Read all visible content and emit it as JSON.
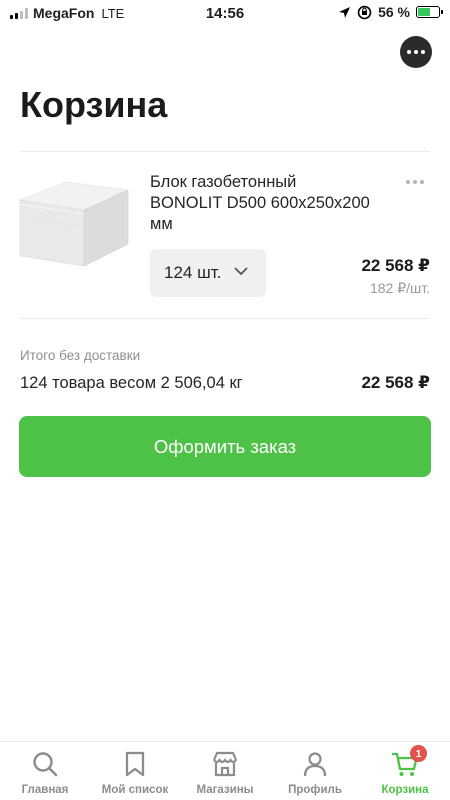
{
  "status_bar": {
    "carrier": "MegaFon",
    "network": "LTE",
    "time": "14:56",
    "battery": "56 %",
    "battery_level": 0.56
  },
  "header": {
    "title": "Корзина",
    "more_icon": "ellipsis-icon"
  },
  "cart": {
    "items": [
      {
        "name": "Блок газобетонный BONOLIT D500 600x250x200 мм",
        "quantity": "124 шт.",
        "total_price": "22 568 ₽",
        "unit_price": "182 ₽/шт."
      }
    ]
  },
  "summary": {
    "caption": "Итого без доставки",
    "description": "124 товара весом 2 506,04 кг",
    "total": "22 568 ₽"
  },
  "checkout": {
    "label": "Оформить заказ"
  },
  "tab_bar": {
    "tabs": [
      {
        "label": "Главная",
        "icon": "search-icon"
      },
      {
        "label": "Мой список",
        "icon": "bookmark-icon"
      },
      {
        "label": "Магазины",
        "icon": "store-icon"
      },
      {
        "label": "Профиль",
        "icon": "person-icon"
      },
      {
        "label": "Корзина",
        "icon": "cart-icon",
        "badge": "1",
        "active": true
      }
    ]
  },
  "colors": {
    "accent": "#4dc247",
    "badge": "#e0524b",
    "muted_text": "#8f8f8f"
  }
}
